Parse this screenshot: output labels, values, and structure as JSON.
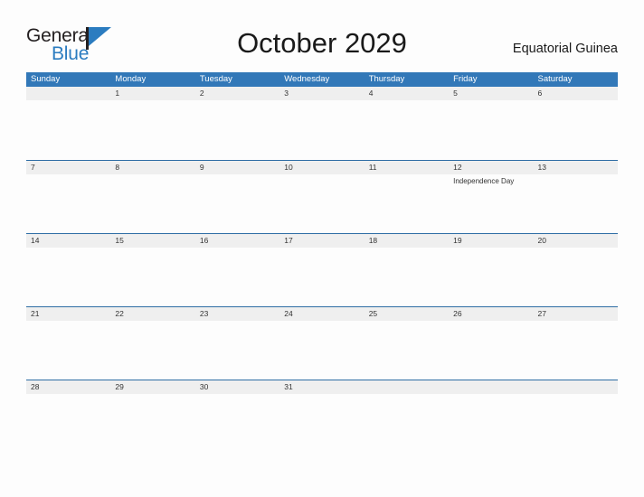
{
  "branding": {
    "logo_word_1": "General",
    "logo_word_2": "Blue",
    "logo_icon": "blue-flag-triangle",
    "accent_color": "#2b7cc0"
  },
  "header": {
    "title": "October 2029",
    "region": "Equatorial Guinea"
  },
  "colors": {
    "header_blue": "#3278b8",
    "row_band_gray": "#efefef",
    "row_divider_blue": "#2e6da4",
    "text_dark": "#333333",
    "page_background": "#fdfdfd"
  },
  "calendar": {
    "weekdays": [
      "Sunday",
      "Monday",
      "Tuesday",
      "Wednesday",
      "Thursday",
      "Friday",
      "Saturday"
    ],
    "weeks": [
      {
        "days": [
          {
            "date": "",
            "event": ""
          },
          {
            "date": "1",
            "event": ""
          },
          {
            "date": "2",
            "event": ""
          },
          {
            "date": "3",
            "event": ""
          },
          {
            "date": "4",
            "event": ""
          },
          {
            "date": "5",
            "event": ""
          },
          {
            "date": "6",
            "event": ""
          }
        ]
      },
      {
        "days": [
          {
            "date": "7",
            "event": ""
          },
          {
            "date": "8",
            "event": ""
          },
          {
            "date": "9",
            "event": ""
          },
          {
            "date": "10",
            "event": ""
          },
          {
            "date": "11",
            "event": ""
          },
          {
            "date": "12",
            "event": "Independence Day"
          },
          {
            "date": "13",
            "event": ""
          }
        ]
      },
      {
        "days": [
          {
            "date": "14",
            "event": ""
          },
          {
            "date": "15",
            "event": ""
          },
          {
            "date": "16",
            "event": ""
          },
          {
            "date": "17",
            "event": ""
          },
          {
            "date": "18",
            "event": ""
          },
          {
            "date": "19",
            "event": ""
          },
          {
            "date": "20",
            "event": ""
          }
        ]
      },
      {
        "days": [
          {
            "date": "21",
            "event": ""
          },
          {
            "date": "22",
            "event": ""
          },
          {
            "date": "23",
            "event": ""
          },
          {
            "date": "24",
            "event": ""
          },
          {
            "date": "25",
            "event": ""
          },
          {
            "date": "26",
            "event": ""
          },
          {
            "date": "27",
            "event": ""
          }
        ]
      },
      {
        "days": [
          {
            "date": "28",
            "event": ""
          },
          {
            "date": "29",
            "event": ""
          },
          {
            "date": "30",
            "event": ""
          },
          {
            "date": "31",
            "event": ""
          },
          {
            "date": "",
            "event": ""
          },
          {
            "date": "",
            "event": ""
          },
          {
            "date": "",
            "event": ""
          }
        ]
      }
    ]
  }
}
